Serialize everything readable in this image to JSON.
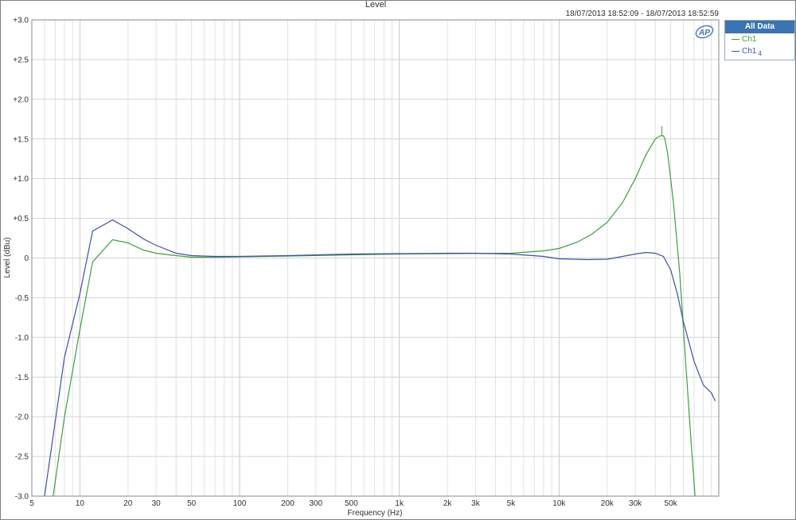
{
  "chart_data": {
    "type": "line",
    "title": "Level",
    "xlabel": "Frequency (Hz)",
    "ylabel": "Level (dBu)",
    "xscale": "log",
    "xlim": [
      5,
      100000
    ],
    "ylim": [
      -3.0,
      3.0
    ],
    "grid": true,
    "timestamp": "18/07/2013 18:52:09 -   18/07/2013 18:52:59",
    "logo": "AP",
    "x_ticks": [
      {
        "value": 5,
        "label": "5"
      },
      {
        "value": 10,
        "label": "10"
      },
      {
        "value": 20,
        "label": "20"
      },
      {
        "value": 30,
        "label": "30"
      },
      {
        "value": 50,
        "label": "50"
      },
      {
        "value": 100,
        "label": "100"
      },
      {
        "value": 200,
        "label": "200"
      },
      {
        "value": 300,
        "label": "300"
      },
      {
        "value": 500,
        "label": "500"
      },
      {
        "value": 1000,
        "label": "1k"
      },
      {
        "value": 2000,
        "label": "2k"
      },
      {
        "value": 3000,
        "label": "3k"
      },
      {
        "value": 5000,
        "label": "5k"
      },
      {
        "value": 10000,
        "label": "10k"
      },
      {
        "value": 20000,
        "label": "20k"
      },
      {
        "value": 30000,
        "label": "30k"
      },
      {
        "value": 50000,
        "label": "50k"
      }
    ],
    "y_ticks": [
      {
        "value": 3.0,
        "label": "+3.0"
      },
      {
        "value": 2.5,
        "label": "+2.5"
      },
      {
        "value": 2.0,
        "label": "+2.0"
      },
      {
        "value": 1.5,
        "label": "+1.5"
      },
      {
        "value": 1.0,
        "label": "+1.0"
      },
      {
        "value": 0.5,
        "label": "+0.5"
      },
      {
        "value": 0,
        "label": "0"
      },
      {
        "value": -0.5,
        "label": "-0.5"
      },
      {
        "value": -1.0,
        "label": "-1.0"
      },
      {
        "value": -1.5,
        "label": "-1.5"
      },
      {
        "value": -2.0,
        "label": "-2.0"
      },
      {
        "value": -2.5,
        "label": "-2.5"
      },
      {
        "value": -3.0,
        "label": "-3.0"
      }
    ],
    "legend": {
      "title": "All Data",
      "position": "top-right-outside"
    },
    "series": [
      {
        "name": "Ch1",
        "subscript": "",
        "color": "#3f9e3f",
        "points": [
          [
            6.8,
            -3.0
          ],
          [
            8,
            -2.0
          ],
          [
            10,
            -0.9
          ],
          [
            12,
            -0.05
          ],
          [
            16,
            0.23
          ],
          [
            20,
            0.19
          ],
          [
            25,
            0.1
          ],
          [
            30,
            0.06
          ],
          [
            40,
            0.03
          ],
          [
            50,
            0.01
          ],
          [
            70,
            0.01
          ],
          [
            100,
            0.015
          ],
          [
            200,
            0.025
          ],
          [
            500,
            0.04
          ],
          [
            1000,
            0.05
          ],
          [
            2000,
            0.055
          ],
          [
            5000,
            0.06
          ],
          [
            8000,
            0.09
          ],
          [
            10000,
            0.12
          ],
          [
            13000,
            0.2
          ],
          [
            16000,
            0.3
          ],
          [
            20000,
            0.45
          ],
          [
            25000,
            0.7
          ],
          [
            30000,
            1.0
          ],
          [
            35000,
            1.3
          ],
          [
            40000,
            1.5
          ],
          [
            43000,
            1.54
          ],
          [
            45000,
            1.54
          ],
          [
            46000,
            1.5
          ],
          [
            48000,
            1.3
          ],
          [
            52000,
            0.7
          ],
          [
            57000,
            -0.2
          ],
          [
            62000,
            -1.3
          ],
          [
            67000,
            -2.3
          ],
          [
            71000,
            -3.0
          ]
        ]
      },
      {
        "name": "Ch1",
        "subscript": "4",
        "color": "#3f4fa8",
        "points": [
          [
            6,
            -3.0
          ],
          [
            8,
            -1.25
          ],
          [
            10,
            -0.45
          ],
          [
            12,
            0.34
          ],
          [
            16,
            0.48
          ],
          [
            20,
            0.37
          ],
          [
            25,
            0.24
          ],
          [
            30,
            0.16
          ],
          [
            40,
            0.06
          ],
          [
            50,
            0.03
          ],
          [
            70,
            0.02
          ],
          [
            100,
            0.02
          ],
          [
            200,
            0.03
          ],
          [
            500,
            0.05
          ],
          [
            1000,
            0.055
          ],
          [
            2000,
            0.06
          ],
          [
            3000,
            0.06
          ],
          [
            5000,
            0.05
          ],
          [
            8000,
            0.02
          ],
          [
            10000,
            -0.01
          ],
          [
            15000,
            -0.02
          ],
          [
            20000,
            -0.015
          ],
          [
            25000,
            0.02
          ],
          [
            30000,
            0.05
          ],
          [
            35000,
            0.07
          ],
          [
            40000,
            0.06
          ],
          [
            45000,
            0.02
          ],
          [
            50000,
            -0.15
          ],
          [
            55000,
            -0.45
          ],
          [
            60000,
            -0.8
          ],
          [
            70000,
            -1.3
          ],
          [
            80000,
            -1.6
          ],
          [
            90000,
            -1.7
          ],
          [
            95000,
            -1.8
          ]
        ]
      }
    ]
  }
}
